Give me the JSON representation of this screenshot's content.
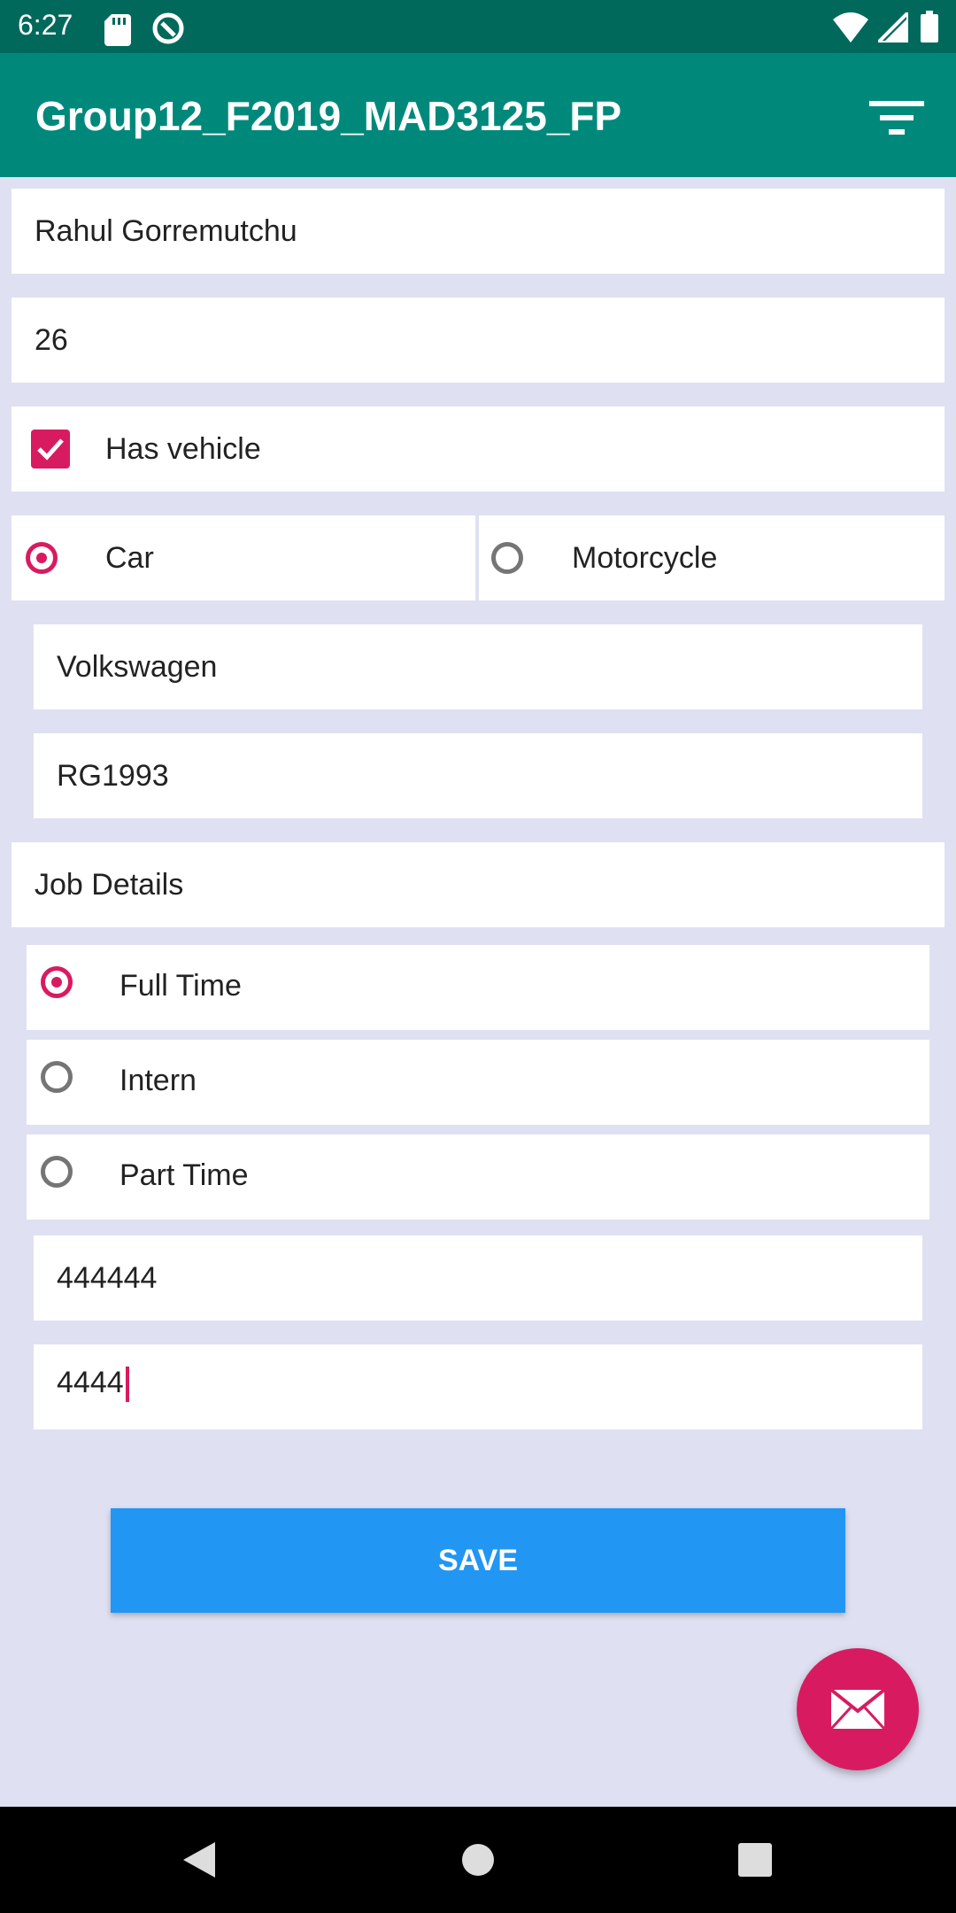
{
  "status_bar": {
    "time": "6:27",
    "icons_left": [
      "sd-card-icon",
      "sync-icon"
    ],
    "icons_right": [
      "wifi-icon",
      "signal-icon",
      "battery-icon"
    ]
  },
  "app_bar": {
    "title": "Group12_F2019_MAD3125_FP",
    "action_icon": "filter-icon"
  },
  "form": {
    "name": "Rahul Gorremutchu",
    "age": "26",
    "has_vehicle_label": "Has vehicle",
    "has_vehicle_checked": true,
    "vehicle_type": {
      "options": [
        "Car",
        "Motorcycle"
      ],
      "selected": "Car"
    },
    "vehicle_make": "Volkswagen",
    "vehicle_plate": "RG1993",
    "job_details_label": "Job Details",
    "job_type": {
      "options": [
        "Full Time",
        "Intern",
        "Part Time"
      ],
      "selected": "Full Time"
    },
    "salary": "444444",
    "bonus": "4444"
  },
  "save_label": "SAVE",
  "fab_icon": "email-icon",
  "colors": {
    "status_bar": "#00695C",
    "app_bar": "#00897B",
    "accent": "#D81B60",
    "save_button": "#2196F3",
    "background": "#DFE1F2"
  },
  "nav": [
    "back-icon",
    "home-icon",
    "recents-icon"
  ]
}
